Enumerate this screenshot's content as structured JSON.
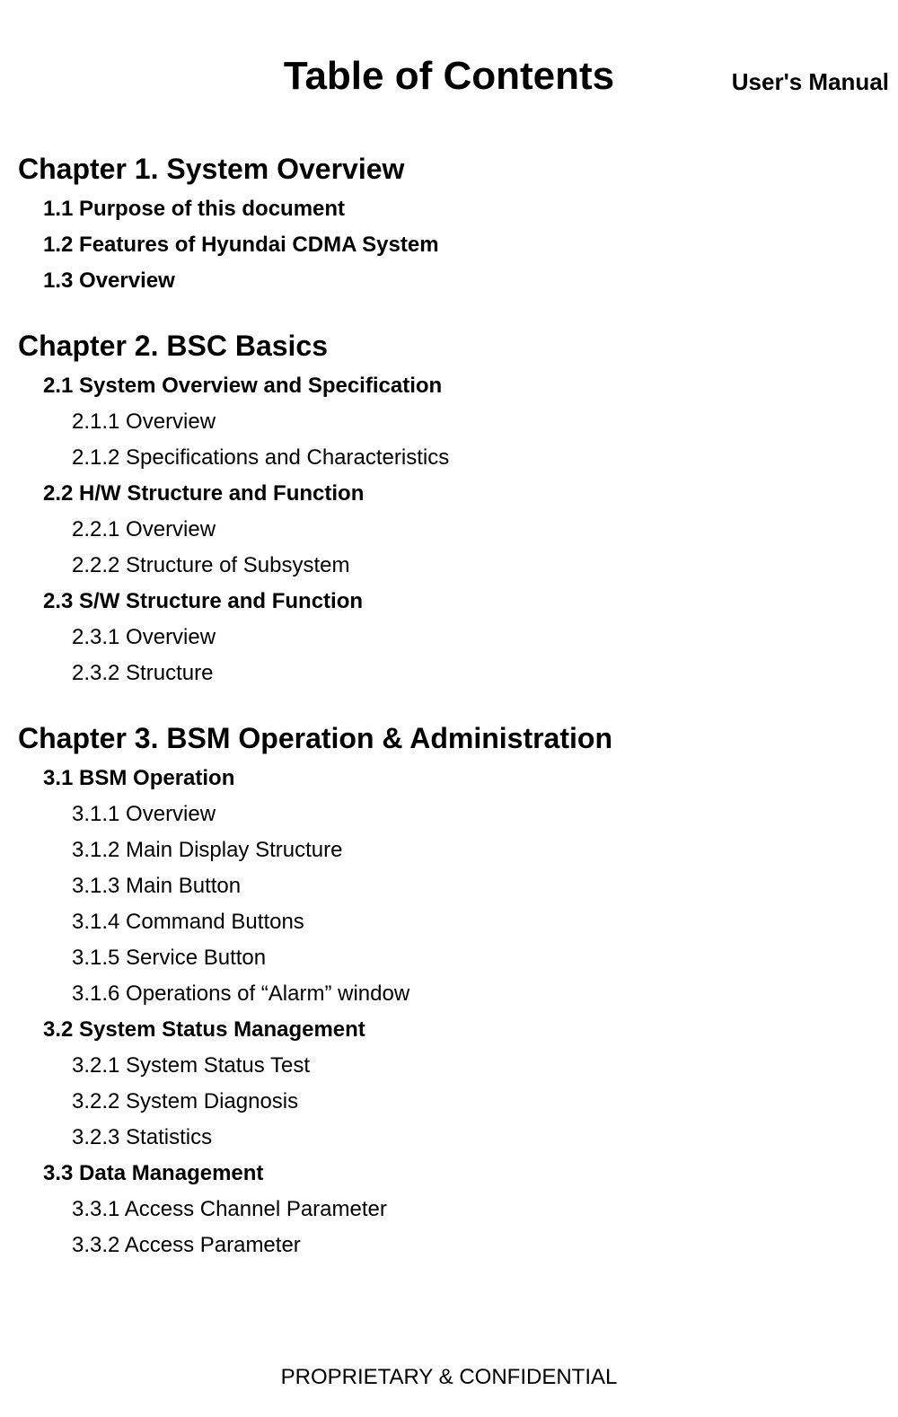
{
  "header": "User's Manual",
  "title": "Table of Contents",
  "footer": "PROPRIETARY & CONFIDENTIAL",
  "chapters": [
    {
      "title": "Chapter 1.  System Overview",
      "sections": [
        {
          "label": "1.1  Purpose of this document",
          "subs": []
        },
        {
          "label": "1.2  Features of Hyundai CDMA System",
          "subs": []
        },
        {
          "label": "1.3  Overview",
          "subs": []
        }
      ]
    },
    {
      "title": "Chapter 2.  BSC Basics",
      "sections": [
        {
          "label": "2.1  System Overview and Specification",
          "subs": [
            "2.1.1  Overview",
            "2.1.2  Specifications and Characteristics"
          ]
        },
        {
          "label": "2.2  H/W Structure and Function",
          "subs": [
            "2.2.1  Overview",
            "2.2.2  Structure of Subsystem"
          ]
        },
        {
          "label": "2.3  S/W Structure and Function",
          "subs": [
            "2.3.1  Overview",
            "2.3.2  Structure"
          ]
        }
      ]
    },
    {
      "title": "Chapter 3.  BSM Operation & Administration",
      "sections": [
        {
          "label": "3.1  BSM Operation",
          "subs": [
            "3.1.1  Overview",
            "3.1.2  Main Display Structure",
            "3.1.3  Main Button",
            "3.1.4  Command Buttons",
            "3.1.5  Service Button",
            "3.1.6  Operations of “Alarm” window"
          ]
        },
        {
          "label": "3.2  System Status Management",
          "subs": [
            "3.2.1  System Status Test",
            "3.2.2  System Diagnosis",
            "3.2.3  Statistics"
          ]
        },
        {
          "label": "3.3  Data Management",
          "subs": [
            "3.3.1  Access Channel Parameter",
            "3.3.2  Access Parameter"
          ]
        }
      ]
    }
  ]
}
